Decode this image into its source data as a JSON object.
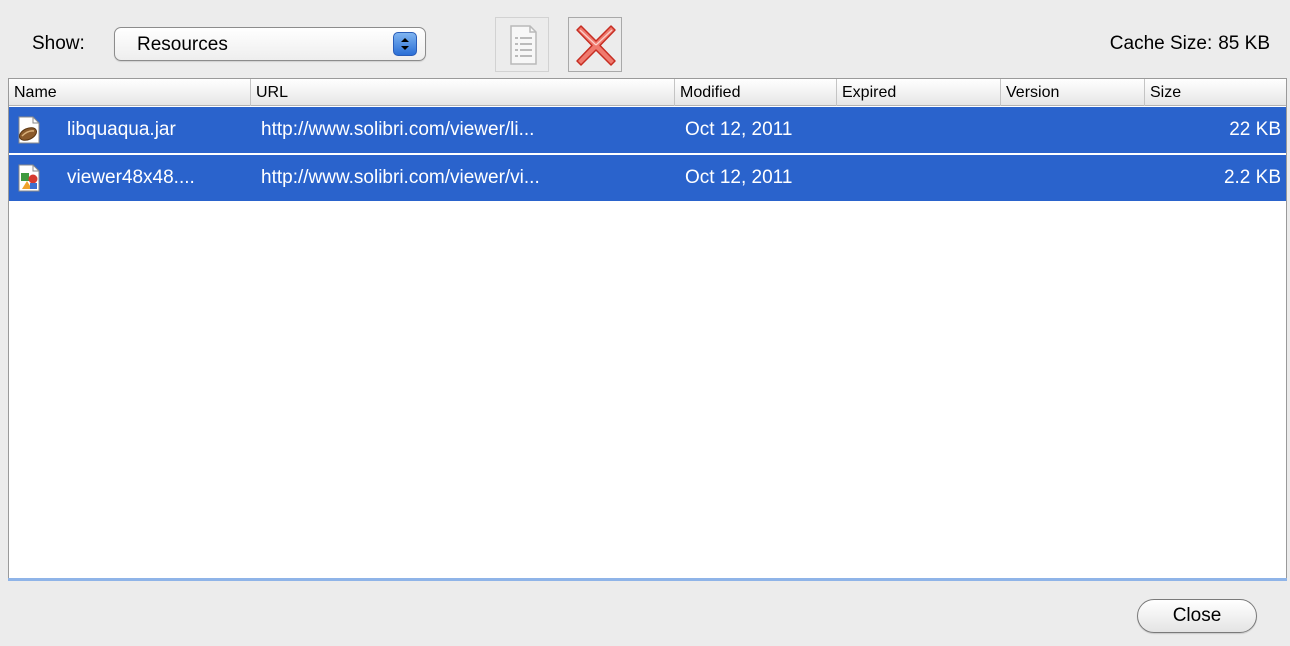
{
  "toolbar": {
    "show_label": "Show:",
    "show_select": {
      "selected": "Resources"
    },
    "details_button": {
      "icon": "document-details-icon"
    },
    "delete_button": {
      "icon": "red-x-delete-icon"
    },
    "cache_size_label": "Cache Size:",
    "cache_size_value": "85 KB"
  },
  "table": {
    "columns": [
      "Name",
      "URL",
      "Modified",
      "Expired",
      "Version",
      "Size"
    ],
    "rows": [
      {
        "icon": "jar-file-icon",
        "name": "libquaqua.jar",
        "url": "http://www.solibri.com/viewer/li...",
        "modified": "Oct 12, 2011",
        "expired": "",
        "version": "",
        "size": "22 KB",
        "selected": true
      },
      {
        "icon": "image-file-icon",
        "name": "viewer48x48....",
        "url": "http://www.solibri.com/viewer/vi...",
        "modified": "Oct 12, 2011",
        "expired": "",
        "version": "",
        "size": "2.2 KB",
        "selected": true
      }
    ]
  },
  "footer": {
    "close_label": "Close"
  },
  "colors": {
    "selection": "#2a63cc",
    "window_bg": "#ececec",
    "delete_red": "#e23b2e"
  }
}
